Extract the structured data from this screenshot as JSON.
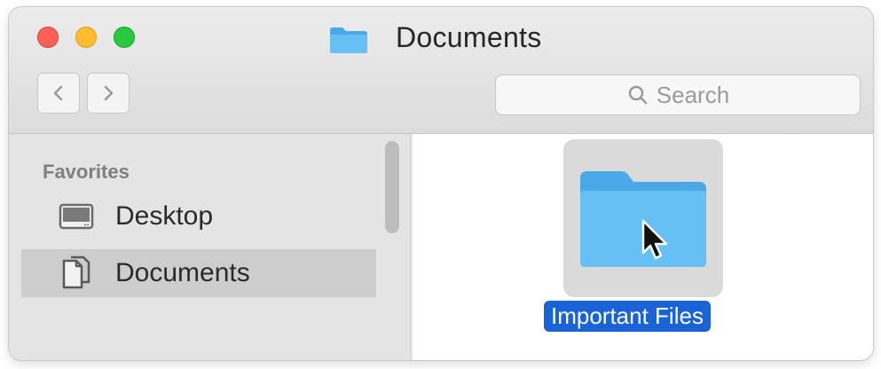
{
  "window": {
    "title": "Documents"
  },
  "search": {
    "placeholder": "Search"
  },
  "sidebar": {
    "heading": "Favorites",
    "items": [
      {
        "label": "Desktop",
        "icon": "desktop-icon"
      },
      {
        "label": "Documents",
        "icon": "documents-icon",
        "selected": true
      }
    ]
  },
  "content": {
    "items": [
      {
        "label": "Important Files",
        "icon": "folder-icon",
        "selected": true
      }
    ]
  },
  "colors": {
    "close": "#fe5f57",
    "minimize": "#febc2e",
    "maximize": "#28c840",
    "folder": "#5bb8ef",
    "selection": "#1a63d6"
  }
}
